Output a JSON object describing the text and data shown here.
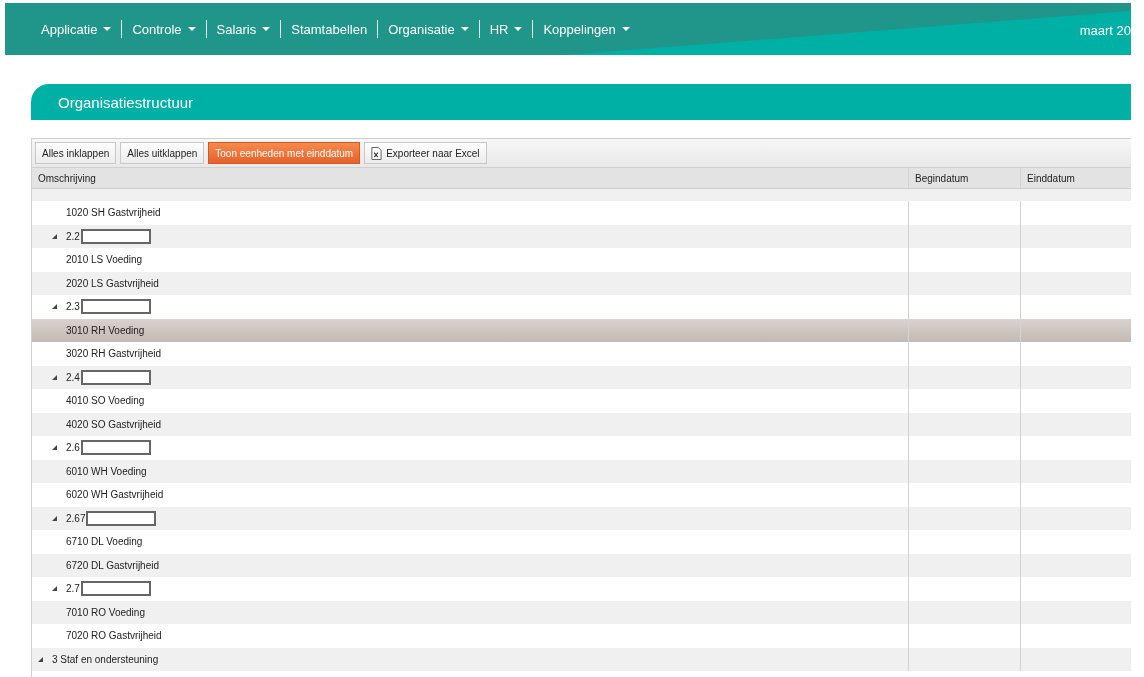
{
  "nav": {
    "items": [
      {
        "label": "Applicatie",
        "has_menu": true
      },
      {
        "label": "Controle",
        "has_menu": true
      },
      {
        "label": "Salaris",
        "has_menu": true
      },
      {
        "label": "Stamtabellen",
        "has_menu": false
      },
      {
        "label": "Organisatie",
        "has_menu": true
      },
      {
        "label": "HR",
        "has_menu": true
      },
      {
        "label": "Koppelingen",
        "has_menu": true
      }
    ],
    "date": "maart 20"
  },
  "page_title": "Organisatiestructuur",
  "toolbar": [
    {
      "label": "Alles inklappen",
      "kind": "plain"
    },
    {
      "label": "Alles uitklappen",
      "kind": "plain"
    },
    {
      "label": "Toon eenheden met einddatum",
      "kind": "active"
    },
    {
      "label": "Exporteer naar Excel",
      "kind": "excel"
    }
  ],
  "table": {
    "columns": [
      "Omschrijving",
      "Begindatum",
      "Einddatum"
    ],
    "tree": [
      {
        "children": [
          {
            "children": [
              {
                "label": "1020 SH Gastvrijheid",
                "highlighted": false
              }
            ]
          },
          {
            "label": "2.2",
            "redacted": true,
            "expanded": true,
            "highlighted": false,
            "children": [
              {
                "label": "2010 LS Voeding",
                "highlighted": false
              },
              {
                "label": "2020 LS Gastvrijheid",
                "highlighted": false
              }
            ]
          },
          {
            "label": "2.3",
            "redacted": true,
            "expanded": true,
            "highlighted": false,
            "children": [
              {
                "label": "3010 RH Voeding",
                "highlighted": true
              },
              {
                "label": "3020 RH Gastvrijheid",
                "highlighted": false
              }
            ]
          },
          {
            "label": "2.4",
            "redacted": true,
            "expanded": true,
            "highlighted": false,
            "children": [
              {
                "label": "4010 SO Voeding",
                "highlighted": false
              },
              {
                "label": "4020 SO Gastvrijheid",
                "highlighted": false
              }
            ]
          },
          {
            "label": "2.6",
            "redacted": true,
            "expanded": true,
            "highlighted": false,
            "children": [
              {
                "label": "6010 WH Voeding",
                "highlighted": false
              },
              {
                "label": "6020 WH Gastvrijheid",
                "highlighted": false
              }
            ]
          },
          {
            "label": "2.67",
            "redacted": true,
            "expanded": true,
            "highlighted": false,
            "children": [
              {
                "label": "6710 DL Voeding",
                "highlighted": false
              },
              {
                "label": "6720 DL Gastvrijheid",
                "highlighted": false
              }
            ]
          },
          {
            "label": "2.7",
            "redacted": true,
            "expanded": true,
            "highlighted": false,
            "children": [
              {
                "label": "7010 RO Voeding",
                "highlighted": false
              },
              {
                "label": "7020 RO Gastvrijheid",
                "highlighted": false
              }
            ]
          }
        ]
      },
      {
        "label": "3 Staf en ondersteuning",
        "expanded": true,
        "highlighted": false
      }
    ]
  }
}
